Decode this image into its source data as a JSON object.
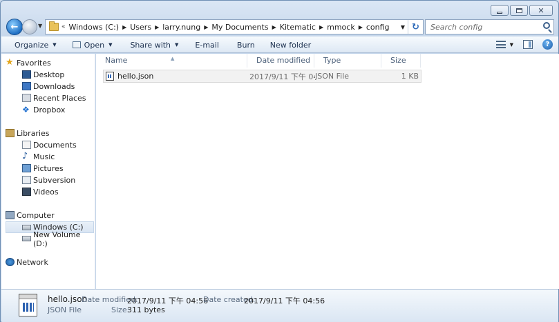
{
  "window": {
    "minimize": "minimize",
    "maximize": "maximize",
    "close": "close"
  },
  "address": {
    "chevron": "«",
    "crumbs": [
      "Windows (C:)",
      "Users",
      "larry.nung",
      "My Documents",
      "Kitematic",
      "mmock",
      "config"
    ]
  },
  "search": {
    "placeholder": "Search config"
  },
  "toolbar": {
    "organize": "Organize",
    "open": "Open",
    "share_with": "Share with",
    "email": "E-mail",
    "burn": "Burn",
    "new_folder": "New folder"
  },
  "nav": {
    "favorites": "Favorites",
    "favorites_items": [
      "Desktop",
      "Downloads",
      "Recent Places",
      "Dropbox"
    ],
    "libraries": "Libraries",
    "libraries_items": [
      "Documents",
      "Music",
      "Pictures",
      "Subversion",
      "Videos"
    ],
    "computer": "Computer",
    "computer_items": [
      "Windows  (C:)",
      "New Volume (D:)"
    ],
    "network": "Network"
  },
  "columns": {
    "name": "Name",
    "date": "Date modified",
    "type": "Type",
    "size": "Size"
  },
  "files": [
    {
      "name": "hello.json",
      "date": "2017/9/11 下午 04:...",
      "type": "JSON File",
      "size": "1 KB"
    }
  ],
  "details": {
    "name": "hello.json",
    "type": "JSON File",
    "date_modified_label": "Date modified:",
    "date_modified": "2017/9/11 下午 04:56",
    "date_created_label": "Date created:",
    "date_created": "2017/9/11 下午 04:56",
    "size_label": "Size:",
    "size": "311 bytes"
  },
  "icons": {
    "back": "back-arrow-icon",
    "forward": "forward-arrow-icon",
    "refresh": "refresh-icon",
    "search": "search-icon",
    "help": "help-icon"
  },
  "colors": {
    "accent": "#2d6ab8",
    "selection": "#d9e5f3",
    "frame": "#c3d5ea"
  }
}
